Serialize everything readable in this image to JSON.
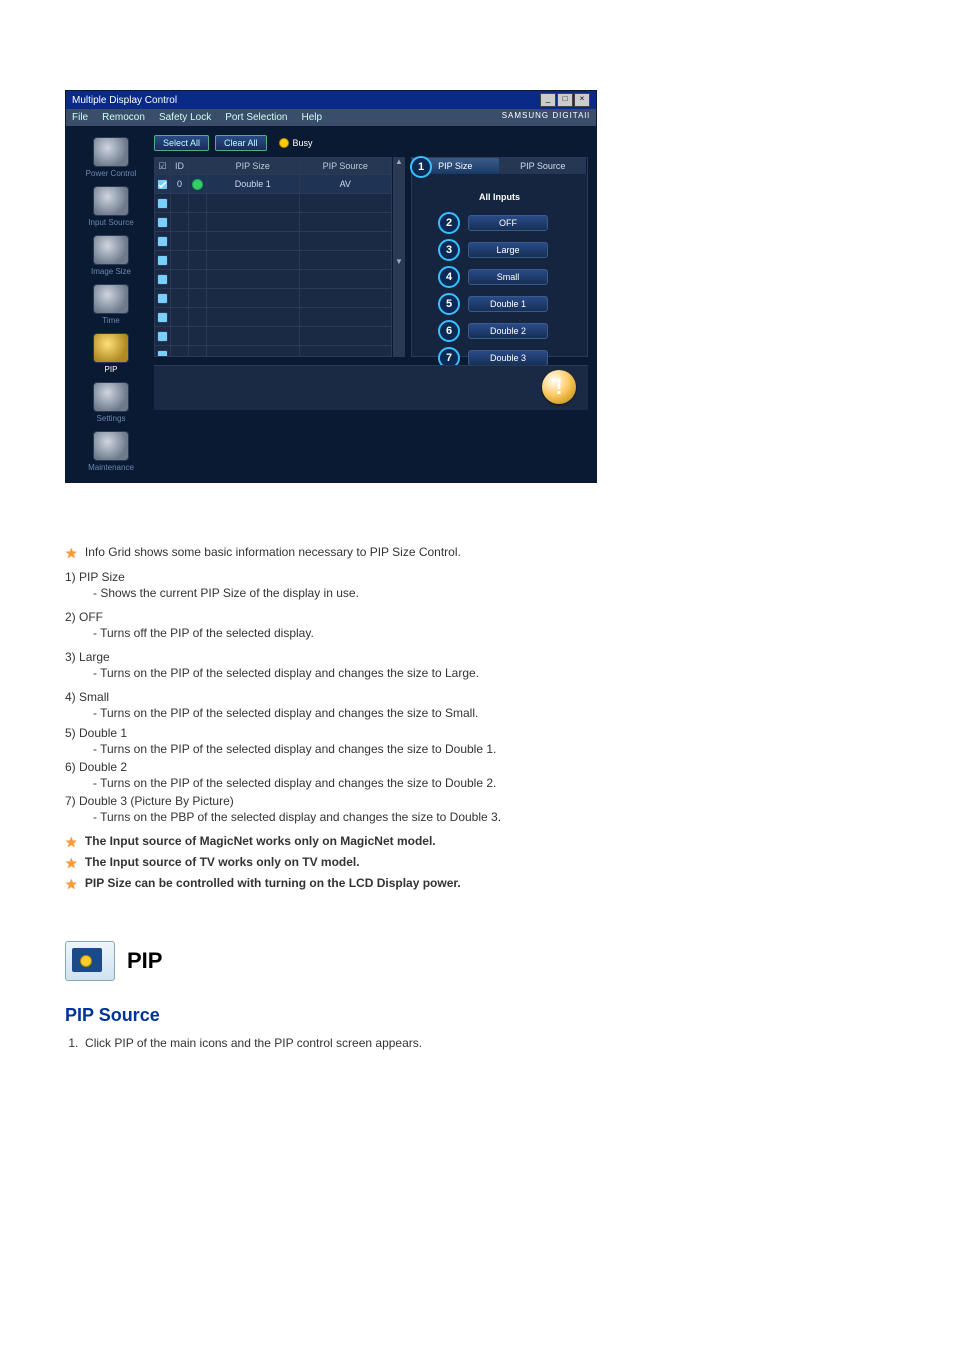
{
  "mdc": {
    "title": "Multiple Display Control",
    "menus": [
      "File",
      "Remocon",
      "Safety Lock",
      "Port Selection",
      "Help"
    ],
    "brand": "SAMSUNG DIGITAll",
    "toolbar": {
      "select_all": "Select All",
      "clear_all": "Clear All",
      "busy": "Busy"
    },
    "sidebar": [
      {
        "label": "Power Control"
      },
      {
        "label": "Input Source"
      },
      {
        "label": "Image Size"
      },
      {
        "label": "Time"
      },
      {
        "label": "PIP",
        "active": true
      },
      {
        "label": "Settings"
      },
      {
        "label": "Maintenance"
      }
    ],
    "grid": {
      "headers": [
        "☑",
        "ID",
        "",
        "PIP Size",
        "PIP Source"
      ],
      "rows": [
        {
          "id": "0",
          "size": "Double 1",
          "source": "AV",
          "status": "green"
        }
      ],
      "empty_rows": 10
    },
    "right": {
      "tabs": [
        "PIP Size",
        "PIP Source"
      ],
      "active_tab": 0,
      "heading": "All Inputs",
      "options": [
        {
          "n": "2",
          "label": "OFF"
        },
        {
          "n": "3",
          "label": "Large"
        },
        {
          "n": "4",
          "label": "Small"
        },
        {
          "n": "5",
          "label": "Double 1"
        },
        {
          "n": "6",
          "label": "Double 2"
        },
        {
          "n": "7",
          "label": "Double 3"
        }
      ],
      "callout1": "1"
    }
  },
  "text": {
    "intro": "Info Grid shows some basic information necessary to PIP Size Control.",
    "items": [
      {
        "n": "1)",
        "title": "PIP Size",
        "desc": "- Shows the current PIP Size of the display in use."
      },
      {
        "n": "2)",
        "title": "OFF",
        "desc": "- Turns off the PIP of the selected display."
      },
      {
        "n": "3)",
        "title": "Large",
        "desc": "- Turns on the PIP of the selected display and changes the size to Large."
      },
      {
        "n": "4)",
        "title": "Small",
        "desc": "- Turns on the PIP of the selected display and changes the size to Small."
      },
      {
        "n": "5)",
        "title": "Double 1",
        "desc": "- Turns on the PIP of the selected display and changes the size to Double 1."
      },
      {
        "n": "6)",
        "title": "Double 2",
        "desc": "- Turns on the PIP of the selected display and changes the size to Double 2."
      },
      {
        "n": "7)",
        "title": "Double 3 (Picture By Picture)",
        "desc": "- Turns on the PBP of the selected display and changes the size to Double 3."
      }
    ],
    "notes": [
      "The Input source of MagicNet works only on MagicNet model.",
      "The Input source of TV works only on TV model.",
      "PIP Size can be controlled with turning on the LCD Display power."
    ]
  },
  "section": {
    "title": "PIP",
    "subtitle": "PIP Source",
    "step1_n": "1.",
    "step1": "Click PIP of the main icons and the PIP control screen appears."
  }
}
